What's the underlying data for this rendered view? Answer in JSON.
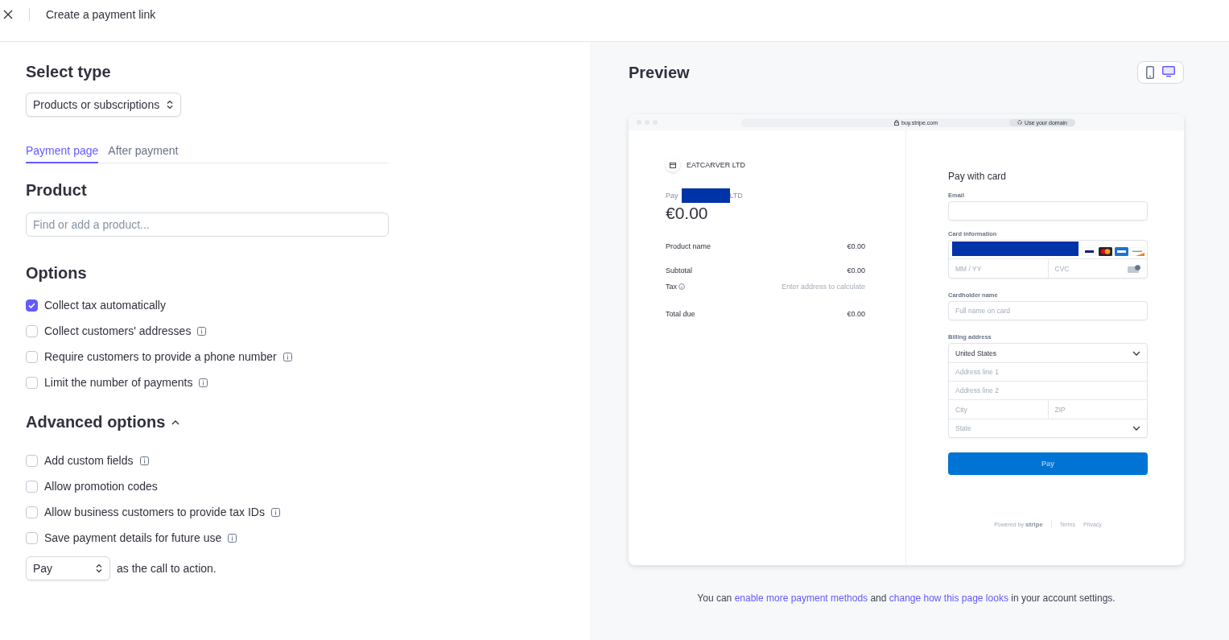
{
  "header": {
    "title": "Create a payment link"
  },
  "select_type": {
    "heading": "Select type",
    "value": "Products or subscriptions"
  },
  "tabs": [
    {
      "label": "Payment page",
      "selected": true
    },
    {
      "label": "After payment",
      "selected": false
    }
  ],
  "product": {
    "heading": "Product",
    "placeholder": "Find or add a product..."
  },
  "options": {
    "heading": "Options",
    "items": [
      {
        "label": "Collect tax automatically",
        "checked": true,
        "info": false
      },
      {
        "label": "Collect customers' addresses",
        "checked": false,
        "info": true
      },
      {
        "label": "Require customers to provide a phone number",
        "checked": false,
        "info": true
      },
      {
        "label": "Limit the number of payments",
        "checked": false,
        "info": true
      }
    ]
  },
  "advanced": {
    "heading": "Advanced options",
    "expanded": true,
    "items": [
      {
        "label": "Add custom fields",
        "checked": false,
        "info": true
      },
      {
        "label": "Allow promotion codes",
        "checked": false,
        "info": false
      },
      {
        "label": "Allow business customers to provide tax IDs",
        "checked": false,
        "info": true
      },
      {
        "label": "Save payment details for future use",
        "checked": false,
        "info": true
      }
    ]
  },
  "cta": {
    "value": "Pay",
    "suffix": "as the call to action."
  },
  "preview": {
    "heading": "Preview",
    "devices": [
      {
        "kind": "mobile",
        "selected": false
      },
      {
        "kind": "desktop",
        "selected": true
      }
    ],
    "url": "buy.stripe.com",
    "domain_button": "Use your domain",
    "merchant": "EATCARVER LTD",
    "pay_prefix": "Pay",
    "pay_suffix": "LTD",
    "amount": "€0.00",
    "lines": [
      {
        "label": "Product name",
        "value": "€0.00"
      }
    ],
    "subtotal": {
      "label": "Subtotal",
      "value": "€0.00"
    },
    "tax": {
      "label": "Tax",
      "value": "Enter address to calculate"
    },
    "total": {
      "label": "Total due",
      "value": "€0.00"
    },
    "form_title": "Pay with card",
    "email_label": "Email",
    "card_label": "Card information",
    "expiry_placeholder": "MM / YY",
    "cvc_placeholder": "CVC",
    "name_label": "Cardholder name",
    "name_placeholder": "Full name on card",
    "billing_label": "Billing address",
    "country": "United States",
    "address1": "Address line 1",
    "address2": "Address line 2",
    "city": "City",
    "zip": "ZIP",
    "state": "State",
    "pay_button": "Pay",
    "powered": "Powered by",
    "brand": "stripe",
    "terms": "Terms",
    "privacy": "Privacy"
  },
  "footer": [
    {
      "text": "You can",
      "link": false
    },
    {
      "text": "enable more payment methods",
      "link": true
    },
    {
      "text": "and",
      "link": false
    },
    {
      "text": "change how this page looks",
      "link": true
    },
    {
      "text": "in your account settings.",
      "link": false
    }
  ]
}
